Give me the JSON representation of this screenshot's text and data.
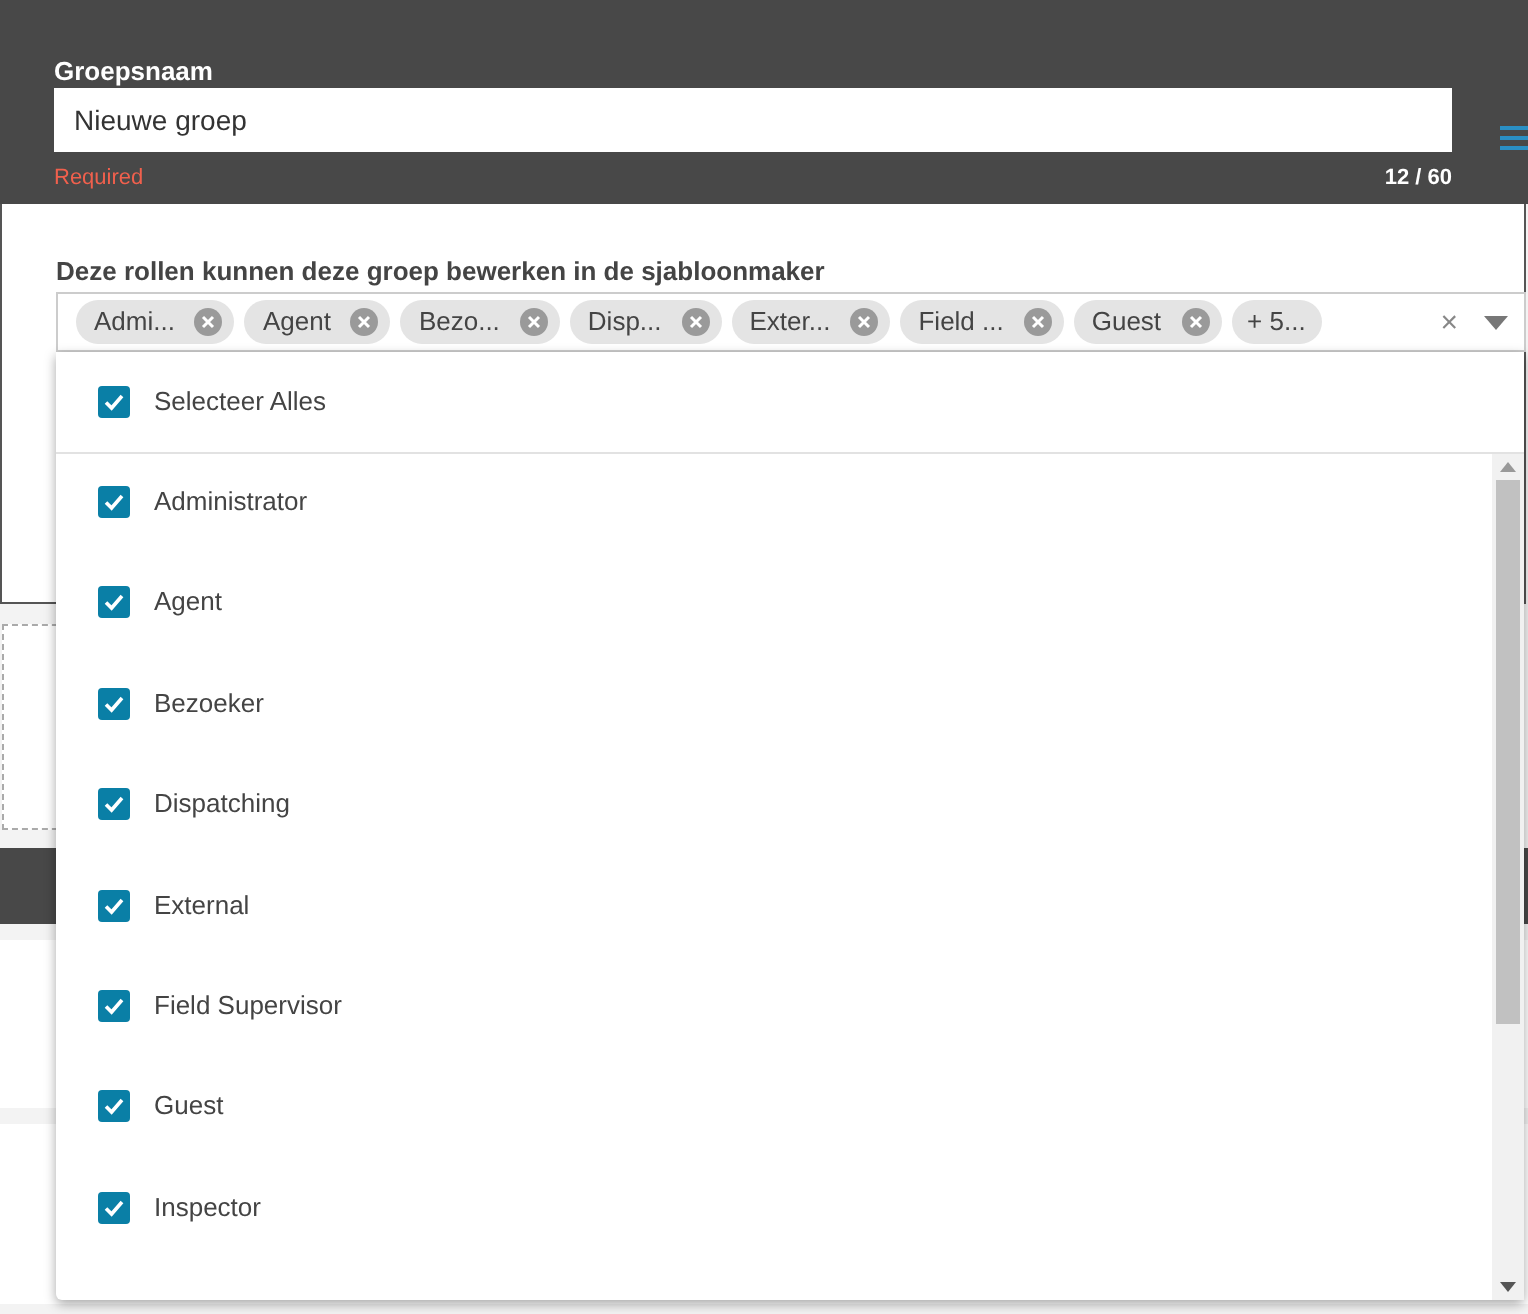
{
  "group_name": {
    "label": "Groepsnaam",
    "value": "Nieuwe groep",
    "error": "Required",
    "counter": "12 / 60"
  },
  "roles": {
    "label": "Deze rollen kunnen deze groep bewerken in de sjabloonmaker",
    "chips": [
      "Admi...",
      "Agent",
      "Bezo...",
      "Disp...",
      "Exter...",
      "Field ...",
      "Guest"
    ],
    "more": "+ 5...",
    "clear": "×",
    "select_all": {
      "label": "Selecteer Alles",
      "checked": true
    },
    "options": [
      {
        "label": "Administrator",
        "checked": true
      },
      {
        "label": "Agent",
        "checked": true
      },
      {
        "label": "Bezoeker",
        "checked": true
      },
      {
        "label": "Dispatching",
        "checked": true
      },
      {
        "label": "External",
        "checked": true
      },
      {
        "label": "Field Supervisor",
        "checked": true
      },
      {
        "label": "Guest",
        "checked": true
      },
      {
        "label": "Inspector",
        "checked": true
      }
    ]
  }
}
